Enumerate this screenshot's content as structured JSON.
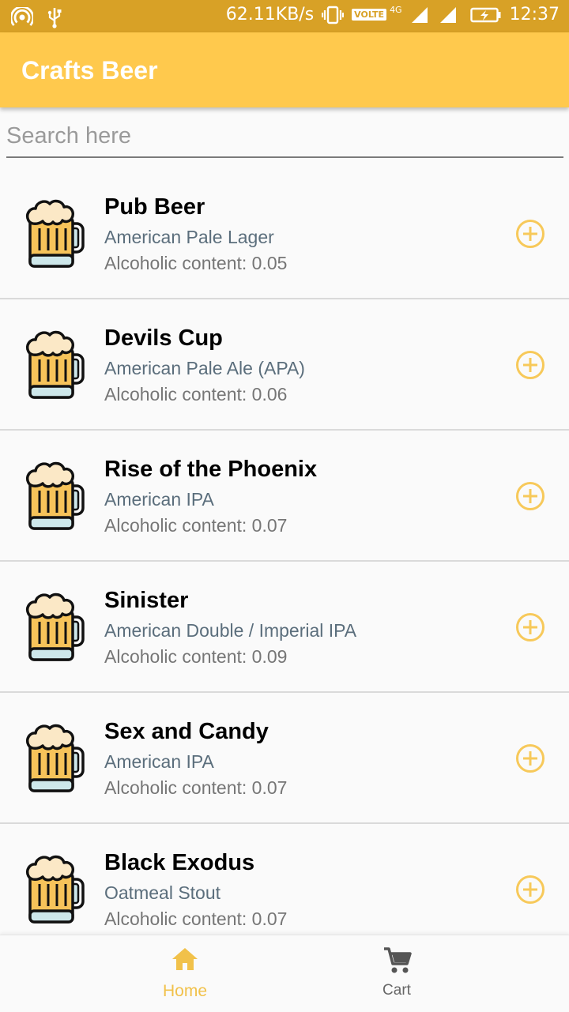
{
  "status_bar": {
    "network_speed": "62.11KB/s",
    "volte": "VOLTE",
    "network_type": "4G",
    "time": "12:37",
    "icons": [
      "hotspot-icon",
      "usb-icon",
      "vibrate-icon",
      "signal-icon",
      "battery-charging-icon"
    ]
  },
  "app_bar": {
    "title": "Crafts Beer"
  },
  "search": {
    "placeholder": "Search here",
    "value": ""
  },
  "beers": [
    {
      "name": "Pub Beer",
      "style": "American Pale Lager",
      "abv": "Alcoholic content: 0.05"
    },
    {
      "name": "Devils Cup",
      "style": "American Pale Ale (APA)",
      "abv": "Alcoholic content: 0.06"
    },
    {
      "name": "Rise of the Phoenix",
      "style": "American IPA",
      "abv": "Alcoholic content: 0.07"
    },
    {
      "name": "Sinister",
      "style": "American Double / Imperial IPA",
      "abv": "Alcoholic content: 0.09"
    },
    {
      "name": "Sex and Candy",
      "style": "American IPA",
      "abv": "Alcoholic content: 0.07"
    },
    {
      "name": "Black Exodus",
      "style": "Oatmeal Stout",
      "abv": "Alcoholic content: 0.07"
    }
  ],
  "bottom_nav": {
    "home_label": "Home",
    "cart_label": "Cart",
    "active": "Home"
  },
  "colors": {
    "status_bar": "#d8a126",
    "app_bar": "#ffc94d",
    "accent": "#f1c14a",
    "add_icon": "#f7c95a"
  }
}
